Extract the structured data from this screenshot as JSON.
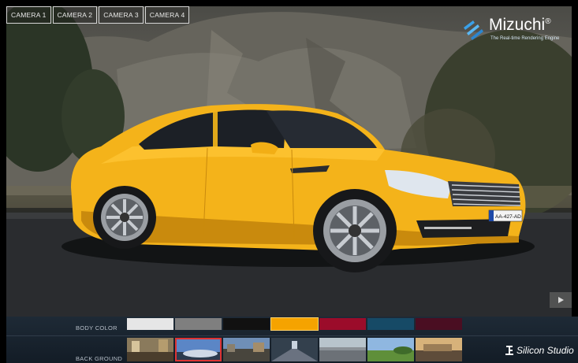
{
  "cameras": [
    "CAMERA 1",
    "CAMERA 2",
    "CAMERA 3",
    "CAMERA 4"
  ],
  "brand": {
    "name": "Mizuchi",
    "registered": "®",
    "tagline": "The Real-time Rendering Engine",
    "icon": "mizuchi-logo-icon"
  },
  "controls": {
    "play_icon": "play-icon"
  },
  "panel": {
    "body_color_label": "BODY COLOR",
    "background_label": "BACK GROUND",
    "body_colors": [
      "#e6e6e6",
      "#7f7f7f",
      "#111111",
      "#f5a300",
      "#9b0c2a",
      "#164a66",
      "#4a0e22"
    ],
    "selected_body_color": 3,
    "backgrounds": [
      "bg-1",
      "bg-2",
      "bg-3",
      "bg-4",
      "bg-5",
      "bg-6",
      "bg-7"
    ],
    "selected_background": 1
  },
  "plate": "AA-427-AD",
  "footer_logo": {
    "text": "Silicon Studio",
    "icon": "silicon-studio-logo-icon"
  }
}
